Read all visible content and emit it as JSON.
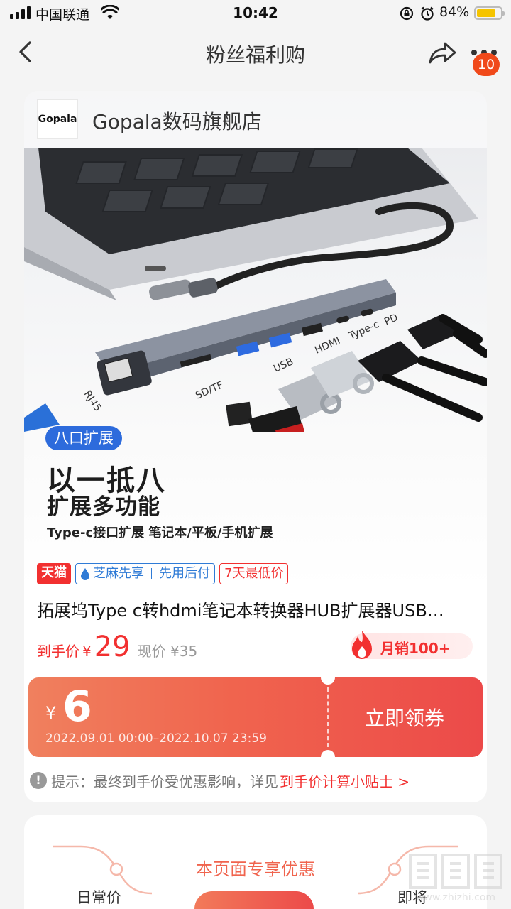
{
  "status_bar": {
    "carrier": "中国联通",
    "time": "10:42",
    "battery": "84%"
  },
  "nav": {
    "title": "粉丝福利购",
    "badge_count": "10"
  },
  "store": {
    "logo_text": "Gopala",
    "name": "Gopala数码旗舰店"
  },
  "hero": {
    "feature_tag": "八口扩展",
    "headline": "以一抵八",
    "subheadline": "扩展多功能",
    "description": "Type-c接口扩展 笔记本/平板/手机扩展",
    "port_labels": [
      "RJ45",
      "SD/TF",
      "USB",
      "HDMI",
      "Type-c",
      "PD"
    ]
  },
  "badges": {
    "platform": "天猫",
    "credit_a": "芝麻先享",
    "credit_b": "先用后付",
    "lowest": "7天最低价"
  },
  "product": {
    "title": "拓展坞Type c转hdmi笔记本转换器HUB扩展器USB…",
    "final_label": "到手价",
    "currency": "¥",
    "final_price": "29",
    "current_price": "现价 ¥35",
    "monthly_sales": "月销100+"
  },
  "coupon": {
    "currency": "¥",
    "amount": "6",
    "period": "2022.09.01 00:00–2022.10.07 23:59",
    "button": "立即领券"
  },
  "tip": {
    "icon": "!",
    "text": "提示：最终到手价受优惠影响，详见",
    "link": "到手价计算小贴士 >"
  },
  "section2": {
    "title": "本页面专享优惠",
    "left_label": "日常价",
    "right_label": "即将"
  },
  "watermark": {
    "text": "www.zhizhi.com"
  },
  "colors": {
    "accent_red": "#f23030",
    "coupon_gradient_start": "#f0805e",
    "coupon_gradient_end": "#ec4a49",
    "tag_blue": "#2d6bdc",
    "zhima_blue": "#2f7bd6"
  }
}
